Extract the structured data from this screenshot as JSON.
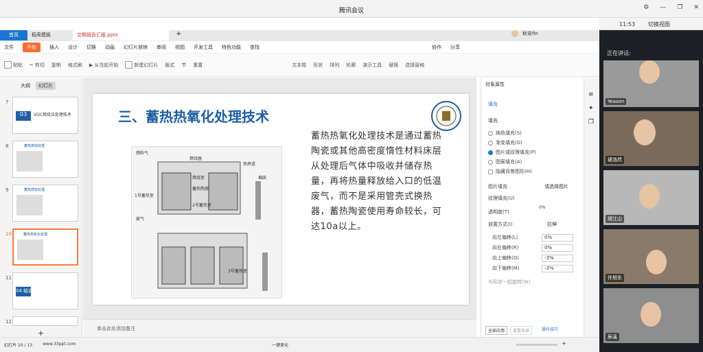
{
  "window": {
    "title": "腾讯会议"
  },
  "tabs": {
    "home": "首页",
    "template": "稻壳模板",
    "file": "交期报告汇报.pptx",
    "user": "秋安fin"
  },
  "menu": [
    "文件",
    "开始",
    "插入",
    "设计",
    "切换",
    "动画",
    "幻灯片放映",
    "审阅",
    "视图",
    "开发工具",
    "特色功能",
    "查找"
  ],
  "menu_right": [
    "协作",
    "分享"
  ],
  "toolbar": [
    "粘贴",
    "剪切",
    "复制",
    "格式刷",
    "从当前开始",
    "新建幻灯片",
    "版式",
    "节",
    "重置",
    "文本框",
    "形状",
    "排列",
    "轮廓",
    "演示工具",
    "替换",
    "选择窗格",
    "图片",
    "填充",
    "查找"
  ],
  "left_panel": {
    "tab_outline": "大纲",
    "tab_slides": "幻灯片",
    "add": "+"
  },
  "thumbnails": [
    {
      "num": "7",
      "label": "VOC燃烧法处理技术"
    },
    {
      "num": "8",
      "label": "蓄热燃烧处理"
    },
    {
      "num": "9",
      "label": "蓄热燃烧处理"
    },
    {
      "num": "10",
      "label": "蓄热热氧化处理"
    },
    {
      "num": "11",
      "label": "04 结语"
    },
    {
      "num": "12",
      "label": ""
    }
  ],
  "slide": {
    "title": "三、蓄热热氧化处理技术",
    "body": "蓄热热氧化处理技术是通过蓄热陶瓷或其他高密度惰性材料床层从处理后气体中吸收并储存热量，再将热量释放给入口的低温废气，而不是采用管壳式换热器，蓄热陶瓷使用寿命较长，可达10a以上。",
    "diagram_labels": [
      "燃料气",
      "燃烧器",
      "热旁道",
      "烟囱",
      "1号蓄热室",
      "2号蓄热室",
      "燃烧室",
      "废气",
      "蓄热陶瓷",
      "3号蓄热室"
    ]
  },
  "notes": {
    "placeholder": "单击此处添加备注"
  },
  "status": {
    "slide": "幻灯片 10 / 13",
    "site": "www.33ppt.com",
    "beautify": "一键美化",
    "zoom": "+"
  },
  "properties": {
    "title": "对象属性",
    "tab_fill": "填充",
    "section_fill": "填充",
    "options": [
      "纯色填充(S)",
      "渐变填充(G)",
      "图片或纹理填充(P)",
      "图案填充(A)",
      "隐藏背景图形(H)"
    ],
    "selected_option": 2,
    "image_fill": {
      "label": "图片填充",
      "value": "请选择图片"
    },
    "texture_fill": {
      "label": "纹理填充(U)"
    },
    "transparency": {
      "label": "透明度(T)",
      "value": "0%"
    },
    "placement": {
      "label": "放置方式(I)",
      "value": "拉伸"
    },
    "offsets": [
      {
        "label": "向左偏移(L)",
        "value": "0%"
      },
      {
        "label": "向右偏移(R)",
        "value": "0%"
      },
      {
        "label": "向上偏移(O)",
        "value": "-3%"
      },
      {
        "label": "向下偏移(M)",
        "value": "-3%"
      }
    ],
    "rotate_with": "与形状一起旋转(W)",
    "apply_all": "全部应用",
    "reset": "重置背景",
    "tips": "操作技巧"
  },
  "meeting": {
    "clock": "11:53",
    "switch_view": "切换视图",
    "speaker_label": "正在讲话:",
    "participants": [
      "Yeason",
      "裙浩然",
      "胡江山",
      "许旭东",
      "辰溪"
    ]
  },
  "colors": {
    "accent": "#ff6a2b",
    "title_blue": "#1d5fa6",
    "meeting_bg": "#1c1f24"
  }
}
